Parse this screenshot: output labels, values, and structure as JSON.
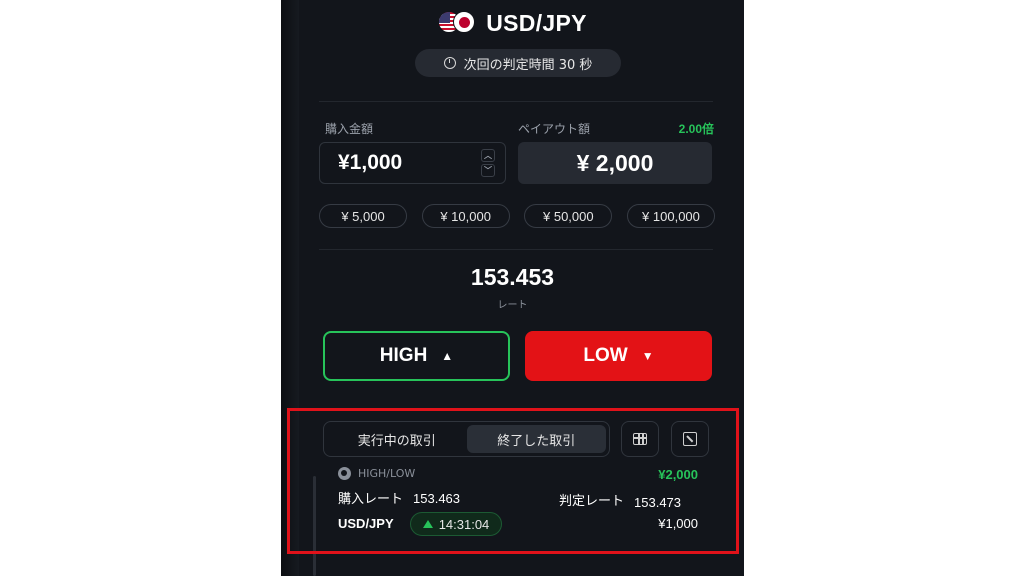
{
  "header": {
    "pair": "USD/JPY",
    "flags": [
      "us-flag",
      "jp-flag"
    ],
    "timer_text": "次回の判定時間 30 秒"
  },
  "purchase": {
    "label": "購入金額",
    "value": "¥1,000",
    "stepper_up": "︿",
    "stepper_down": "﹀"
  },
  "payout": {
    "label": "ペイアウト額",
    "multiplier": "2.00倍",
    "value": "¥ 2,000"
  },
  "presets": [
    "¥ 5,000",
    "¥ 10,000",
    "¥ 50,000",
    "¥ 100,000"
  ],
  "rate": {
    "value": "153.453",
    "label": "レート"
  },
  "actions": {
    "high_label": "HIGH",
    "high_arrow": "▲",
    "low_label": "LOW",
    "low_arrow": "▼"
  },
  "trades": {
    "tabs": [
      {
        "label": "実行中の取引",
        "active": false
      },
      {
        "label": "終了した取引",
        "active": true
      }
    ],
    "item": {
      "type": "HIGH/LOW",
      "payout": "¥2,000",
      "buy_rate_label": "購入レート",
      "buy_rate_value": "153.463",
      "judge_rate_label": "判定レート",
      "judge_rate_value": "153.473",
      "pair": "USD/JPY",
      "time": "14:31:04",
      "amount": "¥1,000"
    }
  },
  "colors": {
    "background": "#12151b",
    "accent_green": "#27c35a",
    "accent_red": "#e31216",
    "highlight": "#e0121a"
  }
}
